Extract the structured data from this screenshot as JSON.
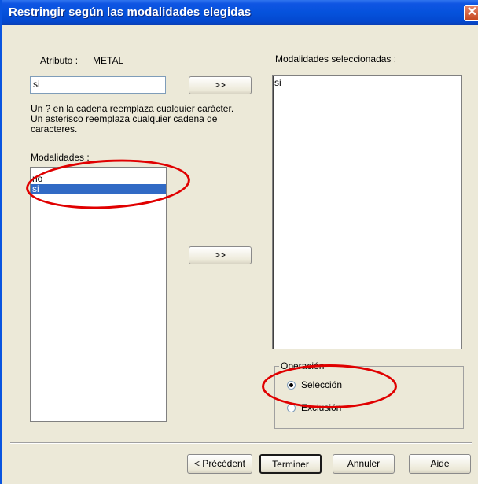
{
  "window": {
    "title": "Restringir según las modalidades elegidas",
    "close_glyph": "✕"
  },
  "left": {
    "attribute_label": "Atributo :",
    "attribute_value": "METAL",
    "filter_value": "si",
    "help_text": [
      "Un ? en la cadena reemplaza cualquier carácter.",
      "Un asterisco reemplaza cualquier cadena de",
      "caracteres."
    ],
    "modalities_label": "Modalidades :",
    "modalities": [
      {
        "label": "no",
        "selected": false
      },
      {
        "label": "si",
        "selected": true
      }
    ]
  },
  "middle": {
    "add_filter_button": ">>",
    "add_selected_button": ">>"
  },
  "right": {
    "selected_label": "Modalidades seleccionadas :",
    "selected_items": [
      "si"
    ],
    "operation_group": "Operación",
    "options": [
      {
        "label": "Selección",
        "checked": true
      },
      {
        "label": "Exclusión",
        "checked": false
      }
    ]
  },
  "footer": {
    "back": "< Précédent",
    "finish": "Terminer",
    "cancel": "Annuler",
    "help": "Aide"
  },
  "annotation_color": "#e00000",
  "icons": {
    "close": "close-icon",
    "radio": "radio-icon"
  }
}
